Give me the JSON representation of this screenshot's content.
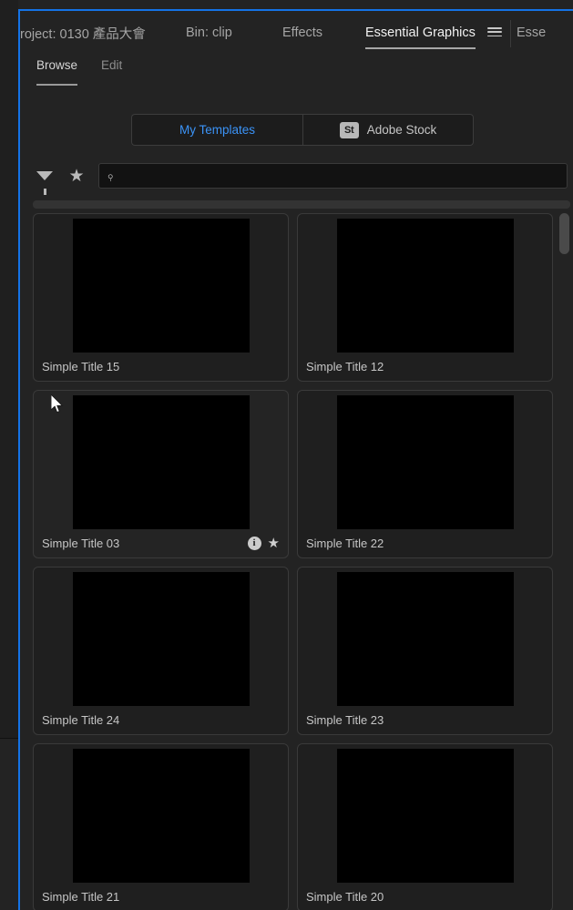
{
  "window": {
    "panel_focus_color": "#1473e6",
    "background": "#232323"
  },
  "tabs": [
    {
      "label": "roject: 0130 產品大會",
      "active": false
    },
    {
      "label": "Bin: clip",
      "active": false
    },
    {
      "label": "Effects",
      "active": false
    },
    {
      "label": "Essential Graphics",
      "active": true
    },
    {
      "label": "Esse",
      "active": false
    }
  ],
  "panel_menu_icon": "hamburger-menu-icon",
  "subtabs": [
    {
      "label": "Browse",
      "active": true
    },
    {
      "label": "Edit",
      "active": false
    }
  ],
  "source_toggle": {
    "my_templates": "My Templates",
    "adobe_stock": "Adobe Stock",
    "stock_badge": "St",
    "active": "My Templates",
    "active_color": "#3b93f7"
  },
  "filter_bar": {
    "filter_icon": "funnel-filter-icon",
    "favorites_icon": "star-icon",
    "search_icon": "search-icon",
    "search_value": "",
    "search_placeholder": ""
  },
  "templates": [
    {
      "label": "Simple Title 15",
      "hovered": false
    },
    {
      "label": "Simple Title 12",
      "hovered": false
    },
    {
      "label": "Simple Title 03",
      "hovered": true
    },
    {
      "label": "Simple Title 22",
      "hovered": false
    },
    {
      "label": "Simple Title 24",
      "hovered": false
    },
    {
      "label": "Simple Title 23",
      "hovered": false
    },
    {
      "label": "Simple Title 21",
      "hovered": false
    },
    {
      "label": "Simple Title 20",
      "hovered": false
    }
  ],
  "card_actions": {
    "info_glyph": "i",
    "star_glyph": "★"
  },
  "glyphs": {
    "star": "★",
    "search": "⌕"
  }
}
